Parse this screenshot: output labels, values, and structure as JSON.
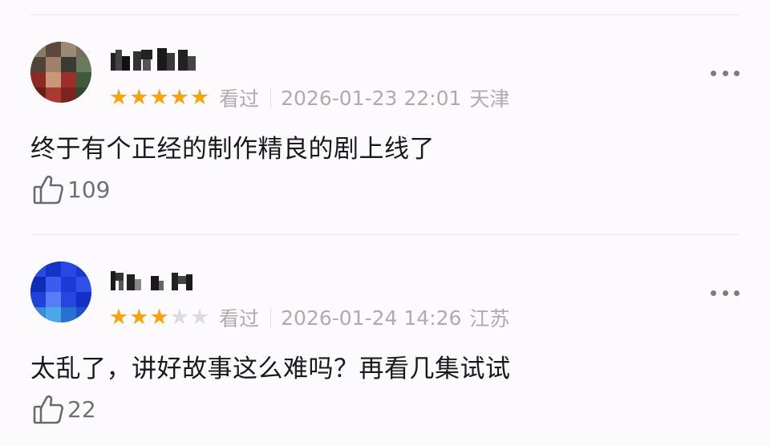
{
  "comments": [
    {
      "username_label": "已打码用户名",
      "rating": 5,
      "rating_max": 5,
      "status": "看过",
      "datetime": "2026-01-23 22:01",
      "location": "天津",
      "text": "终于有个正经的制作精良的剧上线了",
      "likes": "109"
    },
    {
      "username_label": "已打码用户名",
      "rating": 3,
      "rating_max": 5,
      "status": "看过",
      "datetime": "2026-01-24 14:26",
      "location": "江苏",
      "text": "太乱了，讲好故事这么难吗？再看几集试试",
      "likes": "22"
    }
  ],
  "colors": {
    "star_on": "#f7a310",
    "star_off": "#dcdcdc",
    "meta_text": "#aeaaae"
  },
  "icons": [
    "more-icon",
    "thumbs-up-icon",
    "star-icon"
  ]
}
